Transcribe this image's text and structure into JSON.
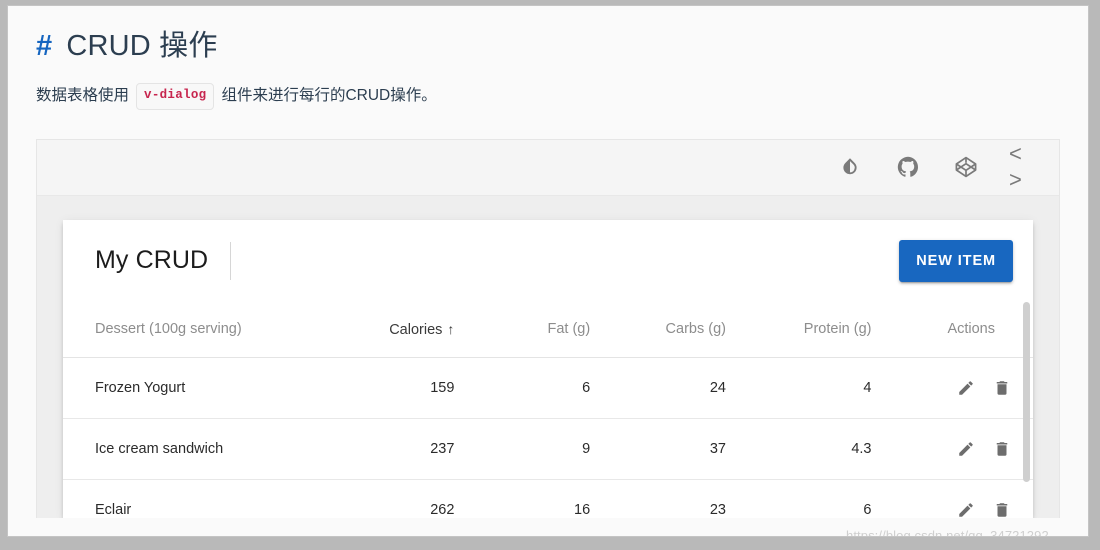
{
  "doc": {
    "anchor": "#",
    "title": "CRUD 操作",
    "subtitle_before": "数据表格使用",
    "code_chip": "v-dialog",
    "subtitle_after": "组件来进行每行的CRUD操作。"
  },
  "example_toolbar": {
    "icons": [
      {
        "name": "theme-toggle-icon",
        "label": "invert-colors"
      },
      {
        "name": "github-icon",
        "label": "github"
      },
      {
        "name": "codepen-icon",
        "label": "codepen"
      },
      {
        "name": "code-view-icon",
        "label": "< >"
      }
    ]
  },
  "card": {
    "title": "My CRUD",
    "new_item_label": "NEW ITEM"
  },
  "table": {
    "columns": [
      {
        "label": "Dessert (100g serving)",
        "align": "left",
        "sorted": false
      },
      {
        "label": "Calories",
        "align": "right",
        "sorted": true,
        "sort_arrow": "↑"
      },
      {
        "label": "Fat (g)",
        "align": "right",
        "sorted": false
      },
      {
        "label": "Carbs (g)",
        "align": "right",
        "sorted": false
      },
      {
        "label": "Protein (g)",
        "align": "right",
        "sorted": false
      },
      {
        "label": "Actions",
        "align": "right",
        "sorted": false
      }
    ],
    "rows": [
      {
        "dessert": "Frozen Yogurt",
        "calories": "159",
        "fat": "6",
        "carbs": "24",
        "protein": "4"
      },
      {
        "dessert": "Ice cream sandwich",
        "calories": "237",
        "fat": "9",
        "carbs": "37",
        "protein": "4.3"
      },
      {
        "dessert": "Eclair",
        "calories": "262",
        "fat": "16",
        "carbs": "23",
        "protein": "6"
      }
    ],
    "row_actions": [
      {
        "name": "edit-icon",
        "label": "edit"
      },
      {
        "name": "delete-icon",
        "label": "delete"
      }
    ]
  },
  "watermark": "https://blog.csdn.net/qq_34721292",
  "colors": {
    "anchor_blue": "#1565c0",
    "primary_button": "#1867c0",
    "code_red": "#c7254e",
    "header_muted": "#8d8d8d"
  }
}
